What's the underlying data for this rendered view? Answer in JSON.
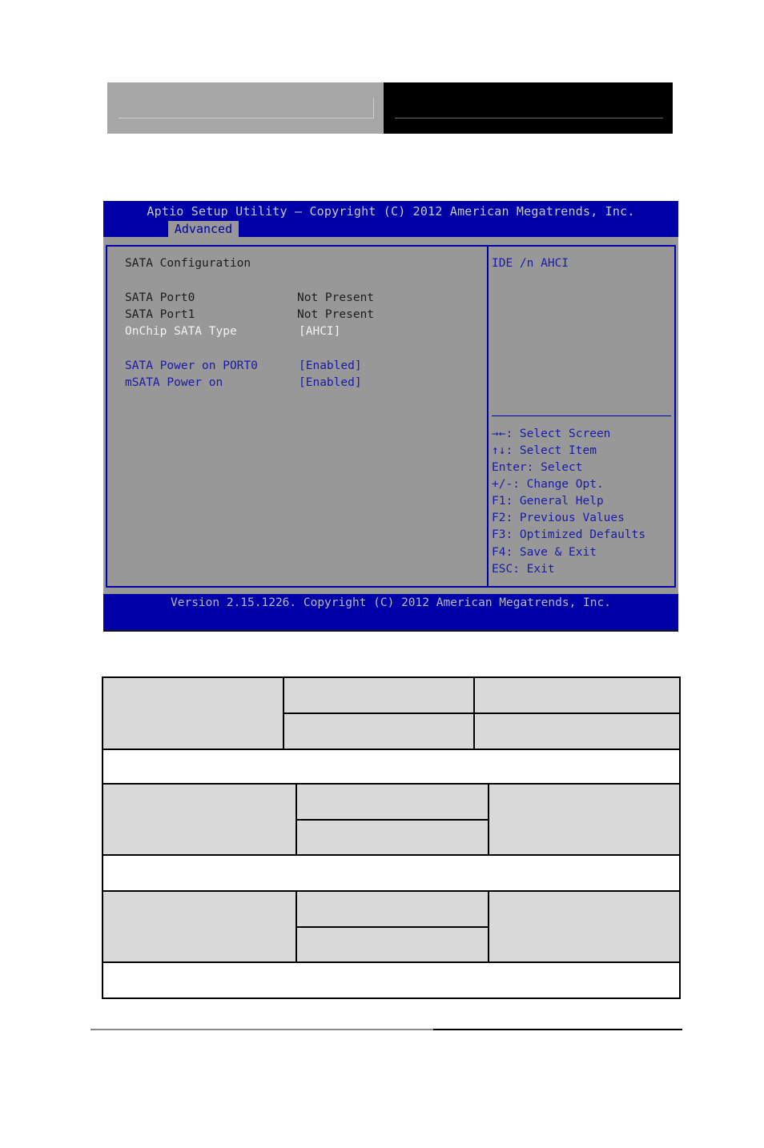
{
  "bios": {
    "title": "Aptio Setup Utility – Copyright (C) 2012 American Megatrends, Inc.",
    "active_tab": "Advanced",
    "section_title": "SATA Configuration",
    "items": [
      {
        "label": "SATA Port0",
        "value": "Not Present",
        "state": "info"
      },
      {
        "label": "SATA Port1",
        "value": "Not Present",
        "state": "info"
      },
      {
        "label": "OnChip SATA Type",
        "value": "[AHCI]",
        "state": "selected"
      },
      {
        "label": "SATA Power on PORT0",
        "value": "[Enabled]",
        "state": "option"
      },
      {
        "label": "mSATA Power on",
        "value": "[Enabled]",
        "state": "option"
      }
    ],
    "help_text": "IDE /n AHCI",
    "key_help": [
      "→←: Select Screen",
      "↑↓: Select Item",
      "Enter: Select",
      "+/-: Change Opt.",
      "F1: General Help",
      "F2: Previous Values",
      "F3: Optimized Defaults",
      "F4: Save & Exit",
      "ESC: Exit"
    ],
    "footer": "Version 2.15.1226. Copyright (C) 2012 American Megatrends, Inc.",
    "colors": {
      "bar": "#0000a8",
      "panel": "#989898",
      "selected_text": "#f2f2f2",
      "option_text": "#1a1aa8"
    }
  }
}
